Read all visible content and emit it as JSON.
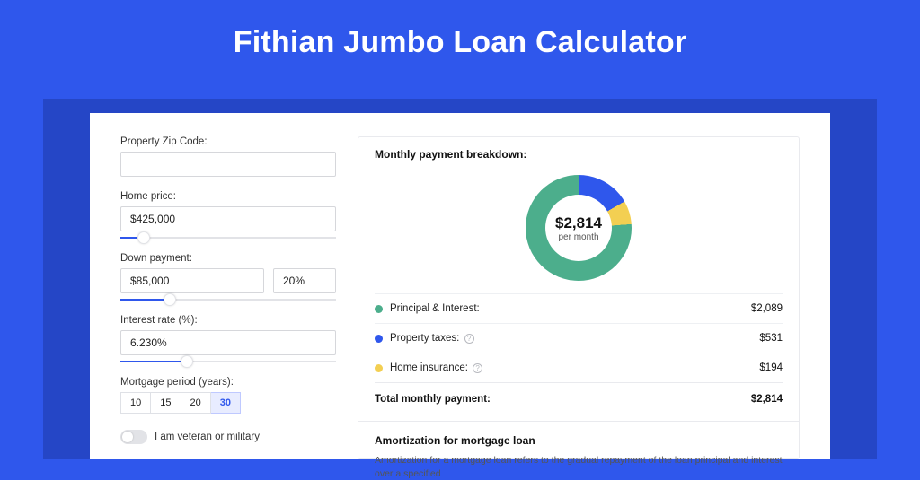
{
  "header": {
    "title": "Fithian Jumbo Loan Calculator"
  },
  "form": {
    "zip": {
      "label": "Property Zip Code:",
      "value": ""
    },
    "price": {
      "label": "Home price:",
      "value": "$425,000",
      "slider_percent": 8
    },
    "down": {
      "label": "Down payment:",
      "value": "$85,000",
      "percent": "20%",
      "slider_percent": 20
    },
    "rate": {
      "label": "Interest rate (%):",
      "value": "6.230%",
      "slider_percent": 28
    },
    "period": {
      "label": "Mortgage period (years):",
      "options": [
        "10",
        "15",
        "20",
        "30"
      ],
      "selected": "30"
    },
    "veteran": {
      "label": "I am veteran or military"
    }
  },
  "breakdown": {
    "title": "Monthly payment breakdown:",
    "center_amount": "$2,814",
    "center_sub": "per month",
    "rows": [
      {
        "name": "Principal & Interest:",
        "value": "$2,089",
        "color": "green",
        "info": false
      },
      {
        "name": "Property taxes:",
        "value": "$531",
        "color": "blue",
        "info": true
      },
      {
        "name": "Home insurance:",
        "value": "$194",
        "color": "yellow",
        "info": true
      }
    ],
    "total_label": "Total monthly payment:",
    "total_value": "$2,814"
  },
  "amortization": {
    "title": "Amortization for mortgage loan",
    "text": "Amortization for a mortgage loan refers to the gradual repayment of the loan principal and interest over a specified"
  },
  "chart_data": {
    "type": "pie",
    "title": "Monthly payment breakdown",
    "series": [
      {
        "name": "Principal & Interest",
        "value": 2089
      },
      {
        "name": "Property taxes",
        "value": 531
      },
      {
        "name": "Home insurance",
        "value": 194
      }
    ],
    "total": 2814,
    "unit": "USD/month"
  }
}
